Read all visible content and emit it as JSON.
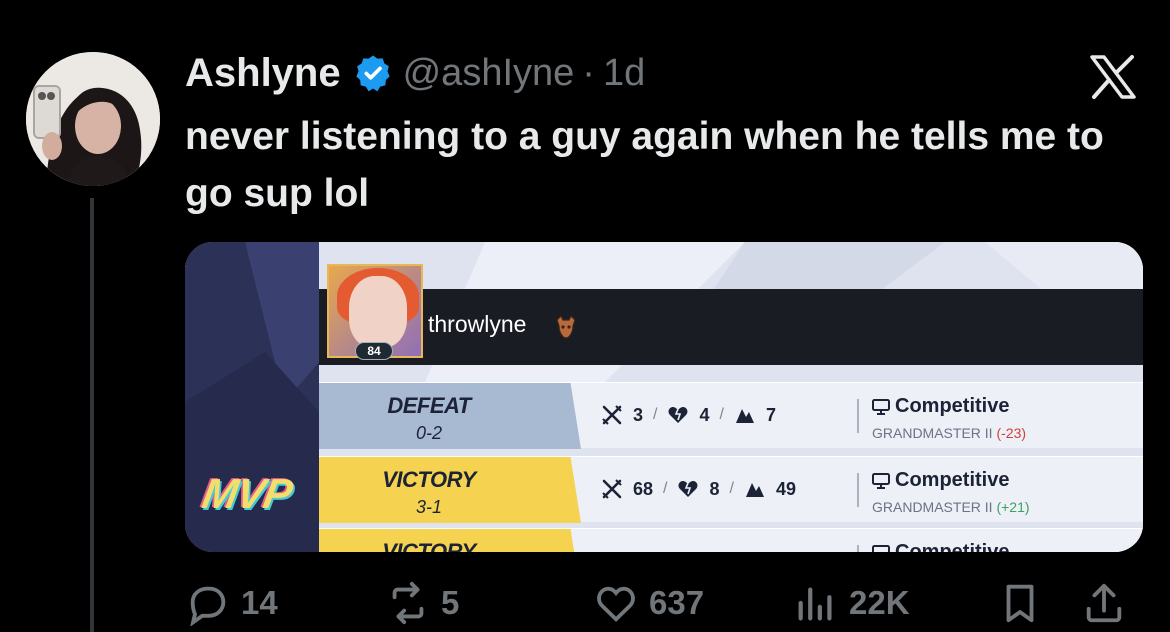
{
  "tweet": {
    "author_name": "Ashlyne",
    "handle": "@ashIyne",
    "separator": "·",
    "time": "1d",
    "text": "never listening to a guy again when he tells me to go sup lol"
  },
  "card": {
    "player_level": "84",
    "username": "throwlyne",
    "mvp_label": "MVP",
    "matches": [
      {
        "result": "DEFEAT",
        "score": "0-2",
        "kills": "3",
        "deaths": "4",
        "assists": "7",
        "mode": "Competitive",
        "rank": "GRANDMASTER II",
        "rank_change": "(-23)"
      },
      {
        "result": "VICTORY",
        "score": "3-1",
        "kills": "68",
        "deaths": "8",
        "assists": "49",
        "mode": "Competitive",
        "rank": "GRANDMASTER II",
        "rank_change": "(+21)"
      },
      {
        "result": "VICTORY",
        "mode": "Competitive"
      }
    ],
    "slash": "/"
  },
  "actions": {
    "replies": "14",
    "reposts": "5",
    "likes": "637",
    "views": "22K"
  },
  "colors": {
    "background": "#000000",
    "text": "#e7e9ea",
    "muted": "#71767b",
    "verified": "#1d9bf0",
    "defeat": "#a8b9d2",
    "victory": "#f5d24f",
    "negative": "#d2403a",
    "positive": "#3ea05f"
  },
  "icons": {
    "verified": "verified-badge-icon",
    "x_logo": "x-logo-icon",
    "reply": "reply-icon",
    "repost": "repost-icon",
    "like": "heart-icon",
    "views": "views-chart-icon",
    "bookmark": "bookmark-icon",
    "share": "share-icon",
    "kills": "crossed-swords-icon",
    "deaths": "broken-heart-icon",
    "assists": "assist-hands-icon",
    "mode": "monitor-icon"
  }
}
